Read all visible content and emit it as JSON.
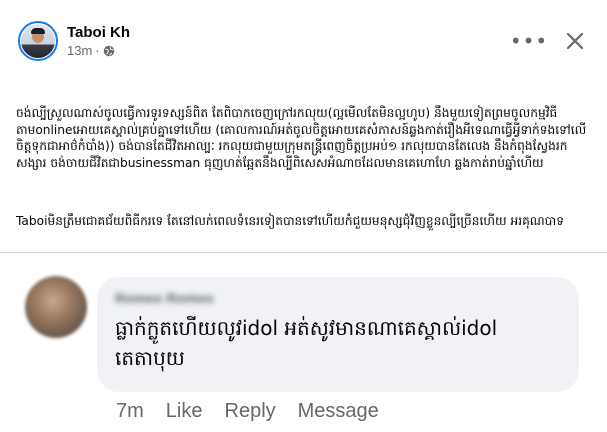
{
  "post": {
    "author": "Taboi Kh",
    "time": "13m",
    "dot": "·",
    "more_glyph": "•••",
    "paragraphs": [
      "ចង់ល្បីស្រួលណាស់ចូលធ្វើការទូរទស្សន៍ពិត តែពិបាកចេញក្រៅរកលុយ(ល្អមើលតែមិនល្អហូប) នឹងមួយទៀតព្រមចូលកម្មវិធីតាមonlineអោយគេស្គាល់គ្រប់គ្នាទៅហើយ (គោលការណ៍អត់ចូលចិត្តអោយគេសំភាសន៍ឆ្លងកាត់រឿងអីទេណាធ្វើអ្វីទាក់ទងទៅលើចិត្តទុកជាអាថ៌កំបាំង)) ចង់បានតែជីវិតអាល្បៈ រកលុយជាមួយក្រុមតន្ត្រីពេញចិត្តប្រអប់១ រកលុយបានតែលេង នឹងកំពុងស្វែងរកសង្សារ ចង់ចាយជីវិតជាbusinessman ធុញហត់ឆ្អែតនឹងល្បីពិសេសអំណាចដែលមានគេហោហែ ឆ្លងកាត់រាប់ឆ្នាំហើយ",
      "Taboiមិនត្រឹមជោគជ័យពិធីករទេ តែនៅលក់ពេលទំនេរទៀតបានទៅហើយកំជួយមនុស្សជុំវិញខ្លួនល្បីច្រើនហើយ អរគុណបាទ"
    ]
  },
  "comment": {
    "author": "Romeo Romeo",
    "text": "ធ្លាក់ក្លូតហើយលូវidol អត់សូវមានណាគេស្គាល់idol តេតាបុយ",
    "time": "7m",
    "actions": [
      "Like",
      "Reply",
      "Message"
    ]
  },
  "icons": {
    "header_more": "more-horizontal-icon",
    "header_close": "close-icon",
    "audience": "globe-icon"
  },
  "colors": {
    "accent": "#1877f2",
    "secondary_text": "#65676b",
    "bubble": "#f0f2f5",
    "divider": "#ced0d4"
  }
}
